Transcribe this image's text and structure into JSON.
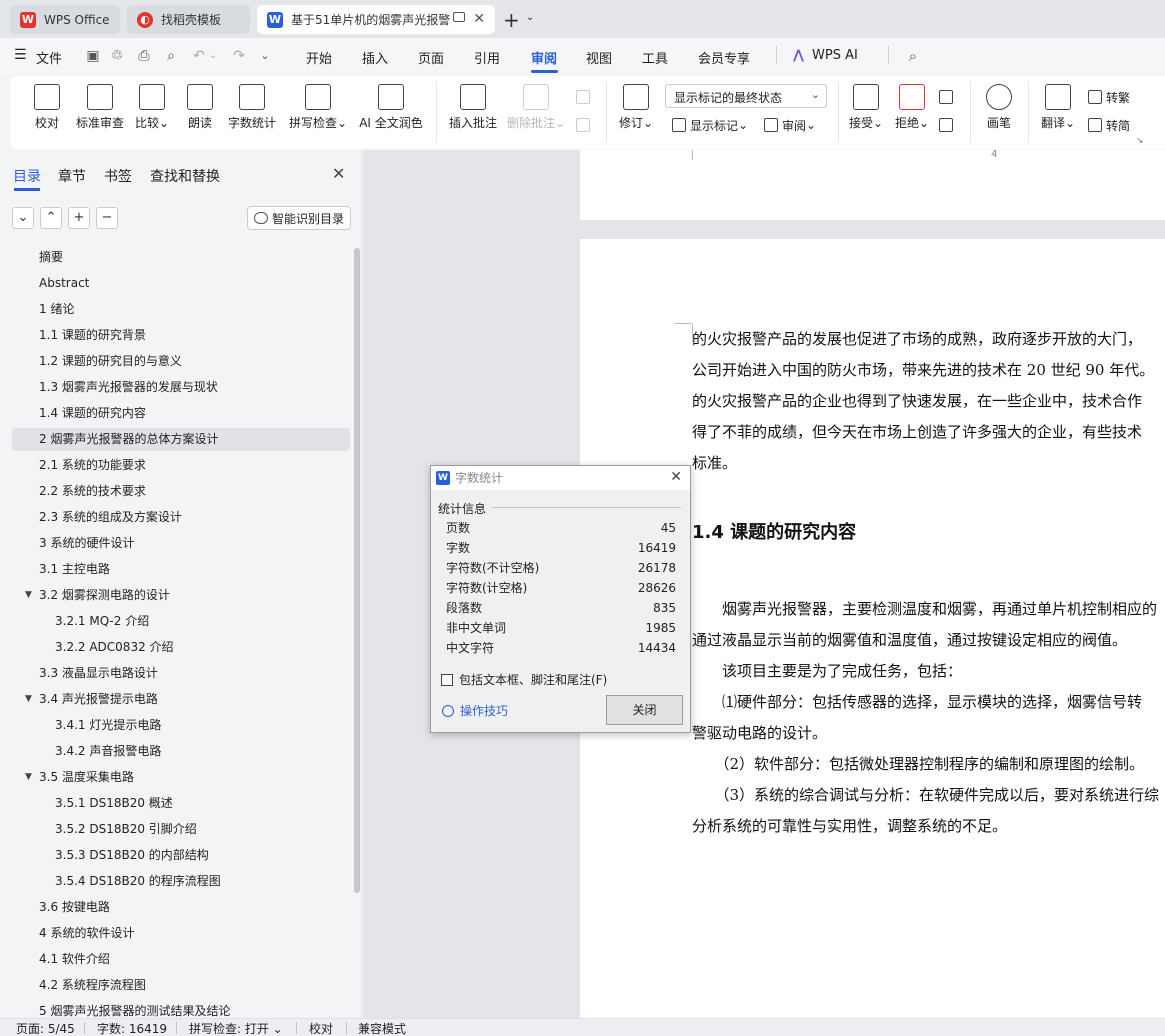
{
  "tabs": [
    {
      "title": "WPS Office",
      "logo": "W"
    },
    {
      "title": "找稻壳模板",
      "logo": "◐"
    },
    {
      "title": "基于51单片机的烟雾声光报警",
      "logo": "W"
    }
  ],
  "menu": {
    "file": "文件",
    "items": [
      "开始",
      "插入",
      "页面",
      "引用",
      "审阅",
      "视图",
      "工具",
      "会员专享"
    ],
    "active": "审阅",
    "ai": "WPS AI"
  },
  "ribbon": {
    "proofread": "校对",
    "standard_review": "标准审查",
    "compare": "比较",
    "read_aloud": "朗读",
    "word_count": "字数统计",
    "spell_check": "拼写检查",
    "ai_polish": "AI 全文润色",
    "insert_comment": "插入批注",
    "delete_comment": "删除批注",
    "track_changes": "修订",
    "markup_display": "显示标记的最终状态",
    "show_markup": "显示标记",
    "review": "审阅",
    "accept": "接受",
    "reject": "拒绝",
    "pen": "画笔",
    "translate": "翻译",
    "to_traditional": "转繁",
    "to_simplified": "转简"
  },
  "nav": {
    "tabs": [
      "目录",
      "章节",
      "书签",
      "查找和替换"
    ],
    "smart_toc": "智能识别目录",
    "toc": [
      {
        "label": "摘要",
        "level": 1
      },
      {
        "label": "Abstract",
        "level": 1
      },
      {
        "label": "1  绪论",
        "level": 1
      },
      {
        "label": "1.1  课题的研究背景",
        "level": 1
      },
      {
        "label": "1.2  课题的研究目的与意义",
        "level": 1
      },
      {
        "label": "1.3  烟雾声光报警器的发展与现状",
        "level": 1
      },
      {
        "label": "1.4 课题的研究内容",
        "level": 1
      },
      {
        "label": "2  烟雾声光报警器的总体方案设计",
        "level": 1,
        "selected": true
      },
      {
        "label": "2.1 系统的功能要求",
        "level": 1
      },
      {
        "label": "2.2  系统的技术要求",
        "level": 1
      },
      {
        "label": "2.3  系统的组成及方案设计",
        "level": 1
      },
      {
        "label": "3  系统的硬件设计",
        "level": 1
      },
      {
        "label": "3.1  主控电路",
        "level": 1
      },
      {
        "label": "3.2  烟雾探测电路的设计",
        "level": 1,
        "expanded": true
      },
      {
        "label": "3.2.1 MQ-2 介绍",
        "level": 2
      },
      {
        "label": "3.2.2 ADC0832 介绍",
        "level": 2
      },
      {
        "label": "3.3  液晶显示电路设计",
        "level": 1
      },
      {
        "label": "3.4  声光报警提示电路",
        "level": 1,
        "expanded": true
      },
      {
        "label": "3.4.1  灯光提示电路",
        "level": 2
      },
      {
        "label": "3.4.2  声音报警电路",
        "level": 2
      },
      {
        "label": "3.5  温度采集电路",
        "level": 1,
        "expanded": true
      },
      {
        "label": "3.5.1 DS18B20 概述",
        "level": 2
      },
      {
        "label": "3.5.2 DS18B20 引脚介绍",
        "level": 2
      },
      {
        "label": "3.5.3 DS18B20 的内部结构",
        "level": 2
      },
      {
        "label": "3.5.4 DS18B20 的程序流程图",
        "level": 2
      },
      {
        "label": "3.6  按键电路",
        "level": 1
      },
      {
        "label": "4  系统的软件设计",
        "level": 1
      },
      {
        "label": "4.1  软件介绍",
        "level": 1
      },
      {
        "label": "4.2  系统程序流程图",
        "level": 1
      },
      {
        "label": "5 烟雾声光报警器的测试结果及结论",
        "level": 1
      }
    ]
  },
  "document": {
    "prev_page_number": "4",
    "lines": [
      "的火灾报警产品的发展也促进了市场的成熟，政府逐步开放的大门，",
      "公司开始进入中国的防火市场，带来先进的技术在 20 世纪 90 年代。",
      "的火灾报警产品的企业也得到了快速发展，在一些企业中，技术合作",
      "得了不菲的成绩，但今天在市场上创造了许多强大的企业，有些技术",
      "标准。"
    ],
    "heading": "1.4 课题的研究内容",
    "lines2": [
      "　　烟雾声光报警器，主要检测温度和烟雾，再通过单片机控制相应的",
      "通过液晶显示当前的烟雾值和温度值，通过按键设定相应的阀值。",
      "　　该项目主要是为了完成任务，包括：",
      "　　⑴硬件部分：包括传感器的选择，显示模块的选择，烟雾信号转",
      "警驱动电路的设计。",
      "　　（2）软件部分：包括微处理器控制程序的编制和原理图的绘制。",
      "　　（3）系统的综合调试与分析：在软硬件完成以后，要对系统进行综",
      "分析系统的可靠性与实用性，调整系统的不足。"
    ]
  },
  "dialog": {
    "title": "字数统计",
    "group": "统计信息",
    "stats": [
      {
        "label": "页数",
        "value": "45"
      },
      {
        "label": "字数",
        "value": "16419"
      },
      {
        "label": "字符数(不计空格)",
        "value": "26178"
      },
      {
        "label": "字符数(计空格)",
        "value": "28626"
      },
      {
        "label": "段落数",
        "value": "835"
      },
      {
        "label": "非中文单词",
        "value": "1985"
      },
      {
        "label": "中文字符",
        "value": "14434"
      }
    ],
    "checkbox": "包括文本框、脚注和尾注(F)",
    "tips": "操作技巧",
    "close": "关闭"
  },
  "status": {
    "page": "页面: 5/45",
    "words": "字数: 16419",
    "spell": "拼写检查: 打开",
    "proof": "校对",
    "compat": "兼容模式"
  },
  "colors": {
    "accent": "#2b5fd9",
    "wps_red": "#e5322d"
  }
}
